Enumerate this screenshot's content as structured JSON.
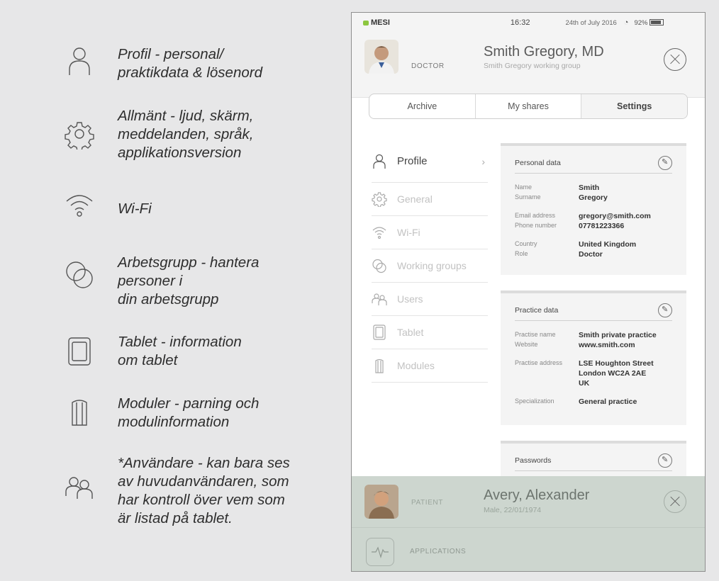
{
  "legend": [
    {
      "icon": "profile-person-icon",
      "text": "Profil - personal/\npraktikdata & lösenord"
    },
    {
      "icon": "gear-icon",
      "text": "Allmänt - ljud, skärm,\nmeddelanden, språk,\napplikationsversion"
    },
    {
      "icon": "wifi-icon",
      "text": "Wi-Fi"
    },
    {
      "icon": "working-groups-icon",
      "text": "Arbetsgrupp - hantera\npersoner i\ndin arbetsgrupp"
    },
    {
      "icon": "tablet-icon",
      "text": "Tablet - information\nom tablet"
    },
    {
      "icon": "module-icon",
      "text": "Moduler - parning och\nmodulinformation"
    },
    {
      "icon": "users-icon",
      "text": "*Användare - kan bara ses\nav huvudanvändaren, som\nhar kontroll över vem som\när listad på tablet."
    }
  ],
  "statusbar": {
    "brand": "MESI",
    "time": "16:32",
    "date": "24th of July 2016",
    "battery": "92%"
  },
  "doctor": {
    "role": "DOCTOR",
    "name": "Smith Gregory, MD",
    "group": "Smith Gregory working group"
  },
  "tabs": [
    "Archive",
    "My shares",
    "Settings"
  ],
  "menu": [
    {
      "label": "Profile",
      "active": true
    },
    {
      "label": "General"
    },
    {
      "label": "Wi-Fi"
    },
    {
      "label": "Working groups"
    },
    {
      "label": "Users"
    },
    {
      "label": "Tablet"
    },
    {
      "label": "Modules"
    }
  ],
  "personal": {
    "title": "Personal data",
    "name_k": "Name",
    "name_v": "Smith",
    "surname_k": "Surname",
    "surname_v": "Gregory",
    "email_k": "Email address",
    "email_v": "gregory@smith.com",
    "phone_k": "Phone number",
    "phone_v": "07781223366",
    "country_k": "Country",
    "country_v": "United Kingdom",
    "role_k": "Role",
    "role_v": "Doctor"
  },
  "practice": {
    "title": "Practice data",
    "pname_k": "Practise name",
    "pname_v": "Smith private practice",
    "web_k": "Website",
    "web_v": "www.smith.com",
    "addr_k": "Practise address",
    "addr_v1": "LSE Houghton Street",
    "addr_v2": "London WC2A 2AE",
    "addr_v3": "UK",
    "spec_k": "Specialization",
    "spec_v": "General practice"
  },
  "passwords": {
    "title": "Passwords"
  },
  "patient": {
    "role": "PATIENT",
    "name": "Avery, Alexander",
    "info": "Male, 22/01/1974"
  },
  "applications": {
    "label": "APPLICATIONS"
  }
}
